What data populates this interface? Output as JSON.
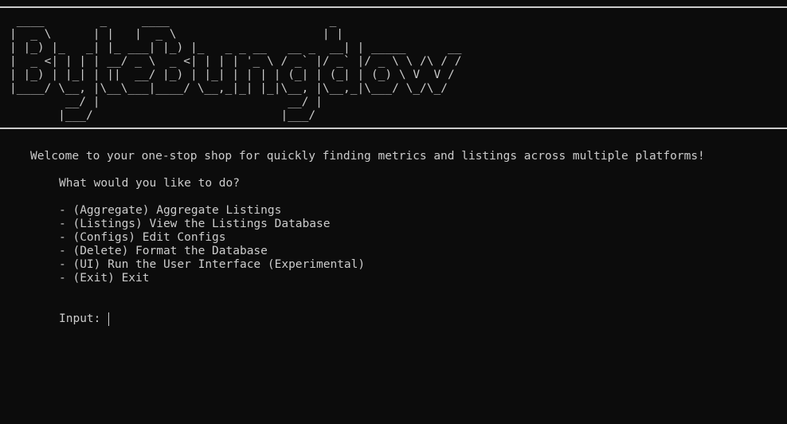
{
  "banner": {
    "ascii_art": " ____        _     ____                       _\n|  _ \\      | |   |  _ \\                     | |\n| |_) |_   _| |_ ___| |_) |_   _ _ __   __ _  __| | _____      __\n|  _ <| | | | __/ _ \\  _ <| | | | '_ \\ / _` |/ _` |/ _ \\ \\ /\\ / /\n| |_) | |_| | ||  __/ |_) | |_| | | | | (_| | (_| | (_) \\ V  V /\n|____/ \\__, |\\__\\___|____/ \\__,_|_| |_|\\__, |\\__,_|\\___/ \\_/\\_/\n        __/ |                           __/ |\n       |___/                           |___/"
  },
  "welcome_text": "Welcome to your one-stop shop for quickly finding metrics and listings across multiple platforms!",
  "question": "What would you like to do?",
  "menu": [
    "- (Aggregate) Aggregate Listings",
    "- (Listings) View the Listings Database",
    "- (Configs) Edit Configs",
    "- (Delete) Format the Database",
    "- (UI) Run the User Interface (Experimental)",
    "- (Exit) Exit"
  ],
  "input": {
    "label": "Input:",
    "value": ""
  },
  "colors": {
    "background": "#0c0c0c",
    "foreground": "#cccccc"
  }
}
